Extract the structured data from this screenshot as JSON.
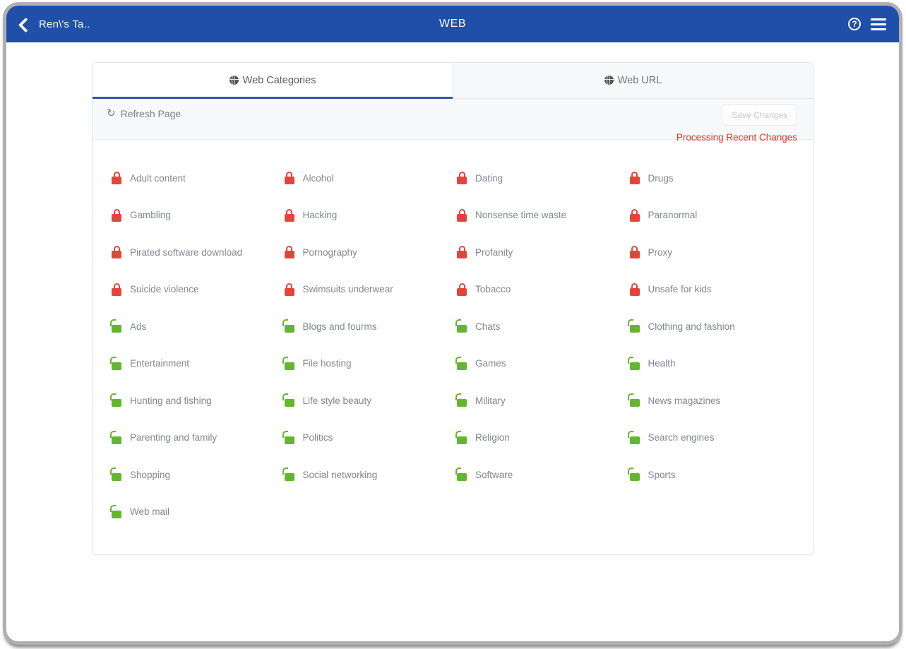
{
  "header": {
    "back_label": "Ren\\'s Ta..",
    "back_icon": "chevron-left-icon",
    "title": "WEB",
    "help_icon": "?",
    "help_icon_name": "help-circle-icon",
    "menu_icon_name": "hamburger-menu-icon"
  },
  "tabs": [
    {
      "label": "Web Categories",
      "icon": "globe-icon",
      "active": true
    },
    {
      "label": "Web URL",
      "icon": "globe-icon",
      "active": false
    }
  ],
  "toolbar": {
    "refresh_label": "Refresh Page",
    "refresh_icon": "↻",
    "save_label": "Save Changes",
    "save_disabled": true,
    "processing_label": "Processing Recent Changes",
    "processing_color": "#e8342a"
  },
  "colors": {
    "header_blue": "#1f4fa8",
    "active_tab_underline": "#2e5a9e",
    "locked_red": "#e4453b",
    "unlocked_green": "#63b62d",
    "label_gray": "#808790"
  },
  "categories": [
    {
      "label": "Adult content",
      "state": "locked",
      "icon": "padlock-closed-icon"
    },
    {
      "label": "Alcohol",
      "state": "locked",
      "icon": "padlock-closed-icon"
    },
    {
      "label": "Dating",
      "state": "locked",
      "icon": "padlock-closed-icon"
    },
    {
      "label": "Drugs",
      "state": "locked",
      "icon": "padlock-closed-icon"
    },
    {
      "label": "Gambling",
      "state": "locked",
      "icon": "padlock-closed-icon"
    },
    {
      "label": "Hacking",
      "state": "locked",
      "icon": "padlock-closed-icon"
    },
    {
      "label": "Nonsense time waste",
      "state": "locked",
      "icon": "padlock-closed-icon"
    },
    {
      "label": "Paranormal",
      "state": "locked",
      "icon": "padlock-closed-icon"
    },
    {
      "label": "Pirated software download",
      "state": "locked",
      "icon": "padlock-closed-icon"
    },
    {
      "label": "Pornography",
      "state": "locked",
      "icon": "padlock-closed-icon"
    },
    {
      "label": "Profanity",
      "state": "locked",
      "icon": "padlock-closed-icon"
    },
    {
      "label": "Proxy",
      "state": "locked",
      "icon": "padlock-closed-icon"
    },
    {
      "label": "Suicide violence",
      "state": "locked",
      "icon": "padlock-closed-icon"
    },
    {
      "label": "Swimsuits underwear",
      "state": "locked",
      "icon": "padlock-closed-icon"
    },
    {
      "label": "Tobacco",
      "state": "locked",
      "icon": "padlock-closed-icon"
    },
    {
      "label": "Unsafe for kids",
      "state": "locked",
      "icon": "padlock-closed-icon"
    },
    {
      "label": "Ads",
      "state": "unlocked",
      "icon": "padlock-open-icon"
    },
    {
      "label": "Blogs and fourms",
      "state": "unlocked",
      "icon": "padlock-open-icon"
    },
    {
      "label": "Chats",
      "state": "unlocked",
      "icon": "padlock-open-icon"
    },
    {
      "label": "Clothing and fashion",
      "state": "unlocked",
      "icon": "padlock-open-icon"
    },
    {
      "label": "Entertainment",
      "state": "unlocked",
      "icon": "padlock-open-icon"
    },
    {
      "label": "File hosting",
      "state": "unlocked",
      "icon": "padlock-open-icon"
    },
    {
      "label": "Games",
      "state": "unlocked",
      "icon": "padlock-open-icon"
    },
    {
      "label": "Health",
      "state": "unlocked",
      "icon": "padlock-open-icon"
    },
    {
      "label": "Hunting and fishing",
      "state": "unlocked",
      "icon": "padlock-open-icon"
    },
    {
      "label": "Life style beauty",
      "state": "unlocked",
      "icon": "padlock-open-icon"
    },
    {
      "label": "Military",
      "state": "unlocked",
      "icon": "padlock-open-icon"
    },
    {
      "label": "News magazines",
      "state": "unlocked",
      "icon": "padlock-open-icon"
    },
    {
      "label": "Parenting and family",
      "state": "unlocked",
      "icon": "padlock-open-icon"
    },
    {
      "label": "Politics",
      "state": "unlocked",
      "icon": "padlock-open-icon"
    },
    {
      "label": "Religion",
      "state": "unlocked",
      "icon": "padlock-open-icon"
    },
    {
      "label": "Search engines",
      "state": "unlocked",
      "icon": "padlock-open-icon"
    },
    {
      "label": "Shopping",
      "state": "unlocked",
      "icon": "padlock-open-icon"
    },
    {
      "label": "Social networking",
      "state": "unlocked",
      "icon": "padlock-open-icon"
    },
    {
      "label": "Software",
      "state": "unlocked",
      "icon": "padlock-open-icon"
    },
    {
      "label": "Sports",
      "state": "unlocked",
      "icon": "padlock-open-icon"
    },
    {
      "label": "Web mail",
      "state": "unlocked",
      "icon": "padlock-open-icon"
    }
  ]
}
